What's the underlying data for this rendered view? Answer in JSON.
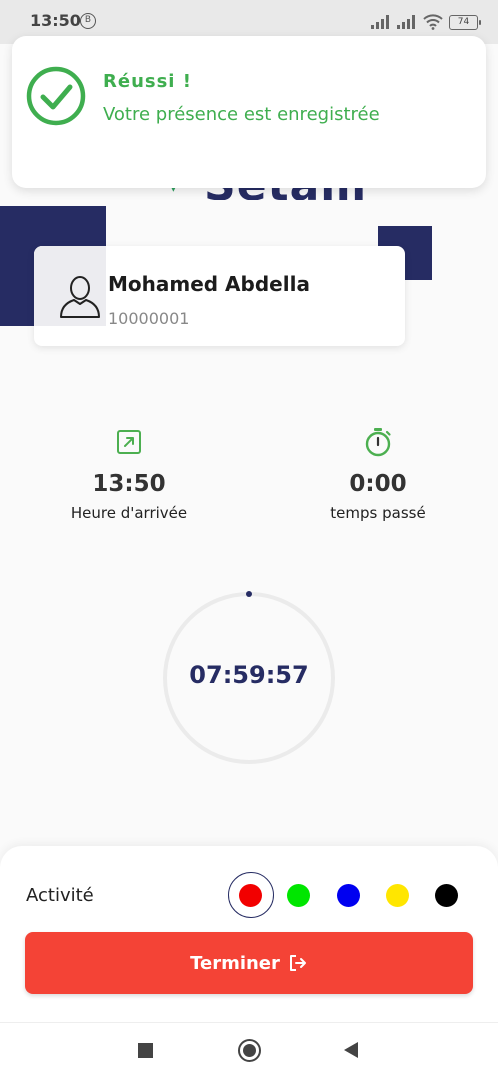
{
  "status_bar": {
    "time": "13:50",
    "notification_glyph": "B",
    "battery_level": "74",
    "icons": [
      "signal-icon",
      "signal-icon",
      "wifi-icon",
      "battery-icon"
    ]
  },
  "toast": {
    "title": "Réussi !",
    "message": "Votre présence est enregistrée",
    "icon": "check-circle-icon",
    "color": "#3fae4f"
  },
  "logo_peek": {
    "text": "Setam"
  },
  "profile": {
    "name": "Mohamed Abdella",
    "id": "10000001",
    "avatar_icon": "user-outline-icon"
  },
  "stats": {
    "arrival": {
      "icon": "arrow-up-right-icon",
      "value": "13:50",
      "label": "Heure d'arrivée"
    },
    "elapsed": {
      "icon": "stopwatch-icon",
      "value": "0:00",
      "label": "temps passé"
    }
  },
  "timer": {
    "value": "07:59:57"
  },
  "activity": {
    "label": "Activité",
    "colors": [
      "#f20000",
      "#00e600",
      "#0000f0",
      "#ffe600",
      "#000000"
    ],
    "selected_index": 0
  },
  "actions": {
    "finish_label": "Terminer",
    "finish_icon": "logout-icon",
    "finish_color": "#f44336"
  },
  "theme": {
    "primary": "#262c63",
    "success": "#3fae4f"
  }
}
